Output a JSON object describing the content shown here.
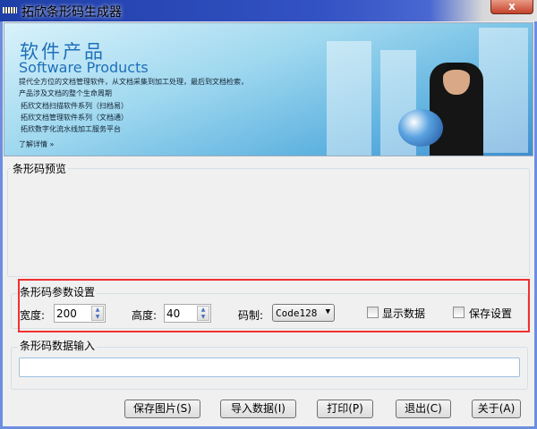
{
  "window": {
    "title": "拓欣条形码生成器",
    "close": "x"
  },
  "banner": {
    "heading": "软件产品",
    "subheading": "Software Products",
    "line1": "提代全方位的文档管理软件，从文档采集到加工处理，最后到文档检索，",
    "line2": "产品涉及文档的整个生命周期",
    "items": [
      "拓欣文档扫描软件系列（扫档易）",
      "拓欣文档管理软件系列（文档通）",
      "拓欣数字化流水线加工服务平台"
    ],
    "more": "了解详情 »"
  },
  "preview": {
    "label": "条形码预览"
  },
  "params": {
    "label": "条形码参数设置",
    "width_label": "宽度:",
    "width_value": "200",
    "height_label": "高度:",
    "height_value": "40",
    "type_label": "码制:",
    "type_value": "Code128",
    "show_data": "显示数据",
    "save_settings": "保存设置"
  },
  "input": {
    "label": "条形码数据输入",
    "value": ""
  },
  "buttons": {
    "save": "保存图片(S)",
    "import": "导入数据(I)",
    "print": "打印(P)",
    "exit": "退出(C)",
    "about": "关于(A)"
  }
}
